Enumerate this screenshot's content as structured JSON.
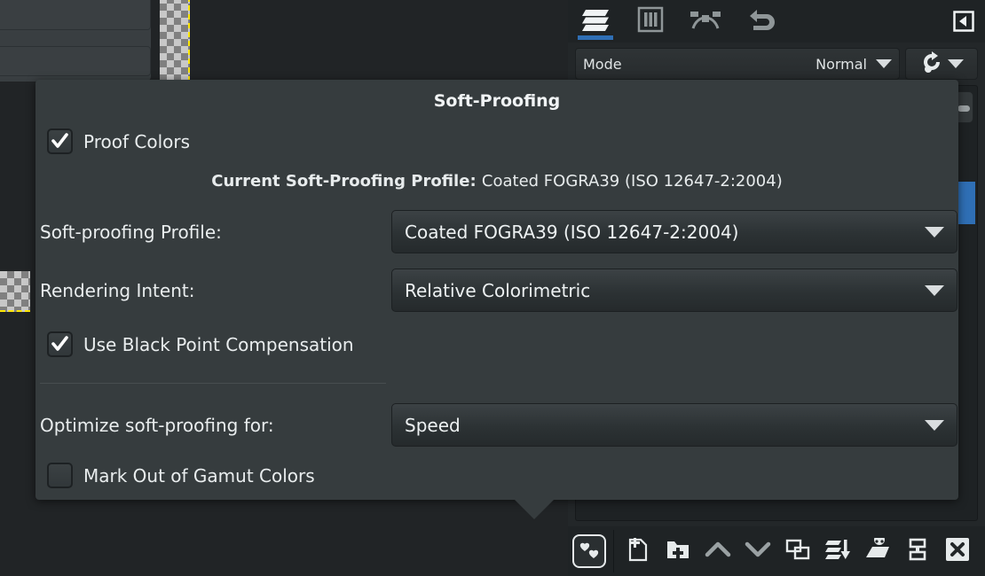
{
  "app": {
    "dock_title": "Layers"
  },
  "dock": {
    "tabs": [
      {
        "name": "layers-tab",
        "icon": "layers-icon",
        "label": "Layers",
        "active": true
      },
      {
        "name": "channels-tab",
        "icon": "channels-icon",
        "label": "Channels",
        "active": false
      },
      {
        "name": "paths-tab",
        "icon": "paths-icon",
        "label": "Paths",
        "active": false
      },
      {
        "name": "undo-tab",
        "icon": "undo-history-icon",
        "label": "Undo History",
        "active": false
      }
    ],
    "collapse_icon": "collapse-left-icon",
    "mode": {
      "label": "Mode",
      "value": "Normal",
      "dropdown_icon": "chevron-down-icon",
      "lock_icon": "lock-alpha-icon"
    },
    "bottom_toolbar": {
      "nav_button_icon": "hearts-preview-icon",
      "buttons": [
        {
          "name": "new-layer-button",
          "icon": "new-layer-icon",
          "label": "Create a new layer"
        },
        {
          "name": "new-layer-group-button",
          "icon": "new-layer-group-icon",
          "label": "Create a new layer group"
        },
        {
          "name": "raise-layer-button",
          "icon": "chevron-up-icon",
          "label": "Raise this layer"
        },
        {
          "name": "lower-layer-button",
          "icon": "chevron-down-icon",
          "label": "Lower this layer"
        },
        {
          "name": "duplicate-layer-button",
          "icon": "duplicate-layer-icon",
          "label": "Duplicate this layer"
        },
        {
          "name": "merge-down-button",
          "icon": "merge-down-icon",
          "label": "Merge down"
        },
        {
          "name": "anchor-layer-button",
          "icon": "anchor-layer-icon",
          "label": "Anchor the floating layer"
        },
        {
          "name": "layer-mask-button",
          "icon": "layer-mask-icon",
          "label": "Add layer mask"
        },
        {
          "name": "delete-layer-button",
          "icon": "delete-layer-icon",
          "label": "Delete this layer"
        }
      ]
    }
  },
  "softproofing": {
    "title": "Soft-Proofing",
    "proof_colors": {
      "label": "Proof Colors",
      "checked": true
    },
    "current_profile": {
      "label": "Current Soft-Proofing Profile",
      "separator": ": ",
      "value": "Coated FOGRA39 (ISO 12647-2:2004)"
    },
    "profile_field": {
      "label": "Soft-proofing Profile:",
      "value": "Coated FOGRA39 (ISO 12647-2:2004)",
      "dropdown_icon": "chevron-down-icon"
    },
    "intent_field": {
      "label": "Rendering Intent:",
      "value": "Relative Colorimetric",
      "dropdown_icon": "chevron-down-icon"
    },
    "black_point": {
      "label": "Use Black Point Compensation",
      "checked": true
    },
    "optimize_field": {
      "label": "Optimize soft-proofing for:",
      "value": "Speed",
      "dropdown_icon": "chevron-down-icon"
    },
    "mark_gamut": {
      "label": "Mark Out of Gamut Colors",
      "checked": false
    }
  },
  "colors": {
    "popover_bg": "#363c3e",
    "dock_bg": "#232729",
    "accent_blue": "#2f6fb5",
    "layer_boundary": "#ffe800",
    "text": "#e9edee"
  }
}
